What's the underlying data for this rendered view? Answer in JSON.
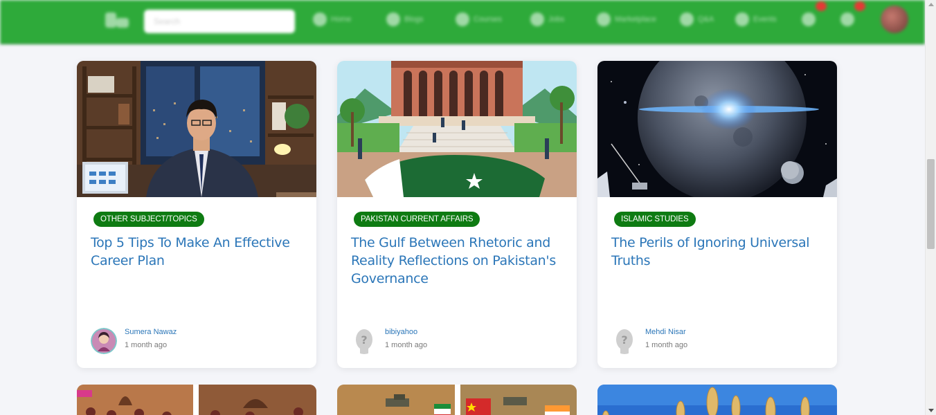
{
  "header": {
    "search_placeholder": "Search",
    "nav": [
      "Home",
      "Blogs",
      "Courses",
      "Jobs",
      "Marketplace",
      "Q&A",
      "Events"
    ]
  },
  "cards": [
    {
      "category": "OTHER SUBJECT/TOPICS",
      "title": "Top 5 Tips To Make An Effective Career Plan",
      "author": "Sumera Nawaz",
      "time": "1 month ago"
    },
    {
      "category": "PAKISTAN CURRENT AFFAIRS",
      "title": "The Gulf Between Rhetoric and Reality Reflections on Pakistan's Governance",
      "author": "bibiyahoo",
      "time": "1 month ago"
    },
    {
      "category": "ISLAMIC STUDIES",
      "title": "The Perils of Ignoring Universal Truths",
      "author": "Mehdi Nisar",
      "time": "1 month ago"
    }
  ],
  "colors": {
    "header_green": "#2eaa3a",
    "category_badge": "#0e7b12",
    "title_link": "#2b76b8"
  }
}
